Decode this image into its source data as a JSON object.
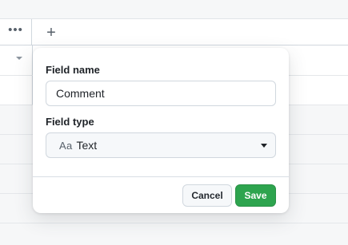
{
  "table": {
    "header": {
      "more_icon_glyph": "•••",
      "add_icon_glyph": "+"
    }
  },
  "popover": {
    "field_name_label": "Field name",
    "field_name_value": "Comment",
    "field_type_label": "Field type",
    "field_type_icon": "Aa",
    "field_type_value": "Text",
    "cancel_label": "Cancel",
    "save_label": "Save"
  },
  "colors": {
    "save_button": "#2da44e",
    "background": "#f6f7f8"
  }
}
